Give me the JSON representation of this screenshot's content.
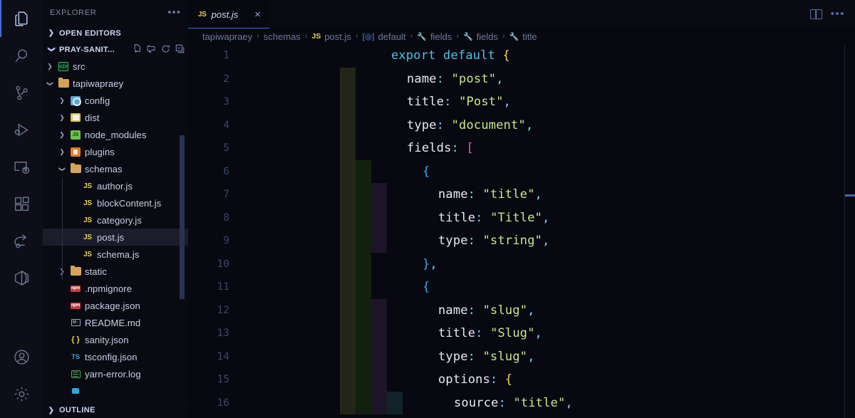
{
  "activitybar": {
    "items": [
      {
        "name": "explorer",
        "icon": "files-icon",
        "active": true
      },
      {
        "name": "search",
        "icon": "search-icon",
        "active": false
      },
      {
        "name": "source-control",
        "icon": "source-control-icon",
        "active": false
      },
      {
        "name": "run-and-debug",
        "icon": "run-debug-icon",
        "active": false
      },
      {
        "name": "remote-explorer",
        "icon": "remote-explorer-icon",
        "active": false
      },
      {
        "name": "extensions",
        "icon": "extensions-icon",
        "active": false
      },
      {
        "name": "live-share",
        "icon": "live-share-icon",
        "active": false
      },
      {
        "name": "docker",
        "icon": "docker-icon",
        "active": false
      }
    ],
    "bottom": [
      {
        "name": "accounts",
        "icon": "account-icon"
      },
      {
        "name": "manage-settings",
        "icon": "gear-icon"
      }
    ]
  },
  "sidebar": {
    "title": "EXPLORER",
    "more_actions": "•••",
    "sections": [
      {
        "label": "OPEN EDITORS",
        "expanded": false
      },
      {
        "label": "PRAY-SANIT...",
        "expanded": true,
        "actions": [
          "new-file",
          "new-folder",
          "refresh",
          "collapse-all"
        ]
      }
    ],
    "tree": [
      {
        "label": "src",
        "depth": 1,
        "kind": "folder",
        "icon": "src-folder-icon",
        "twisty": "collapsed",
        "selected": false
      },
      {
        "label": "tapiwapraey",
        "depth": 1,
        "kind": "folder",
        "icon": "folder-icon",
        "twisty": "expanded",
        "selected": false
      },
      {
        "label": "config",
        "depth": 2,
        "kind": "folder",
        "icon": "config-folder-icon",
        "twisty": "collapsed",
        "selected": false
      },
      {
        "label": "dist",
        "depth": 2,
        "kind": "folder",
        "icon": "dist-folder-icon",
        "twisty": "collapsed",
        "selected": false
      },
      {
        "label": "node_modules",
        "depth": 2,
        "kind": "folder",
        "icon": "node-folder-icon",
        "twisty": "collapsed",
        "selected": false
      },
      {
        "label": "plugins",
        "depth": 2,
        "kind": "folder",
        "icon": "plugins-folder-icon",
        "twisty": "collapsed",
        "selected": false
      },
      {
        "label": "schemas",
        "depth": 2,
        "kind": "folder",
        "icon": "folder-icon",
        "twisty": "expanded",
        "selected": false
      },
      {
        "label": "author.js",
        "depth": 3,
        "kind": "file",
        "icon": "js-file-icon",
        "twisty": "none",
        "selected": false
      },
      {
        "label": "blockContent.js",
        "depth": 3,
        "kind": "file",
        "icon": "js-file-icon",
        "twisty": "none",
        "selected": false
      },
      {
        "label": "category.js",
        "depth": 3,
        "kind": "file",
        "icon": "js-file-icon",
        "twisty": "none",
        "selected": false
      },
      {
        "label": "post.js",
        "depth": 3,
        "kind": "file",
        "icon": "js-file-icon",
        "twisty": "none",
        "selected": true
      },
      {
        "label": "schema.js",
        "depth": 3,
        "kind": "file",
        "icon": "js-file-icon",
        "twisty": "none",
        "selected": false
      },
      {
        "label": "static",
        "depth": 2,
        "kind": "folder",
        "icon": "folder-icon",
        "twisty": "collapsed",
        "selected": false
      },
      {
        "label": ".npmignore",
        "depth": 2,
        "kind": "file",
        "icon": "npm-file-icon",
        "twisty": "none",
        "selected": false
      },
      {
        "label": "package.json",
        "depth": 2,
        "kind": "file",
        "icon": "npm-file-icon",
        "twisty": "none",
        "selected": false
      },
      {
        "label": "README.md",
        "depth": 2,
        "kind": "file",
        "icon": "markdown-file-icon",
        "twisty": "none",
        "selected": false
      },
      {
        "label": "sanity.json",
        "depth": 2,
        "kind": "file",
        "icon": "json-file-icon",
        "twisty": "none",
        "selected": false
      },
      {
        "label": "tsconfig.json",
        "depth": 2,
        "kind": "file",
        "icon": "tsconfig-file-icon",
        "twisty": "none",
        "selected": false
      },
      {
        "label": "yarn-error.log",
        "depth": 2,
        "kind": "file",
        "icon": "log-file-icon",
        "twisty": "none",
        "selected": false
      },
      {
        "label": "",
        "depth": 2,
        "kind": "file",
        "icon": "lock-file-icon",
        "twisty": "none",
        "selected": false
      }
    ],
    "bottom_section": {
      "label": "OUTLINE",
      "expanded": false
    }
  },
  "editor": {
    "tabs": [
      {
        "label": "post.js",
        "icon": "js-file-icon",
        "active": true,
        "preview": true,
        "close": "×"
      }
    ],
    "actions": [
      {
        "name": "split-editor-right",
        "icon": "split-editor-icon"
      },
      {
        "name": "more-editor-actions",
        "icon": "ellipsis-icon"
      }
    ],
    "breadcrumbs": [
      {
        "label": "tapiwapraey",
        "icon": null
      },
      {
        "label": "schemas",
        "icon": null
      },
      {
        "label": "post.js",
        "icon": "js-file-icon"
      },
      {
        "label": "default",
        "icon": "symbol-object-icon"
      },
      {
        "label": "fields",
        "icon": "symbol-property-icon"
      },
      {
        "label": "fields",
        "icon": "symbol-property-icon"
      },
      {
        "label": "title",
        "icon": "symbol-property-icon"
      }
    ],
    "separator": "›",
    "language": "javascript",
    "first_visible_line": 1,
    "lines": [
      {
        "n": 1,
        "indent": 0,
        "tokens": [
          {
            "t": "export default ",
            "c": "kw"
          },
          {
            "t": "{",
            "c": "b1"
          }
        ]
      },
      {
        "n": 2,
        "indent": 1,
        "tokens": [
          {
            "t": "name",
            "c": "prop"
          },
          {
            "t": ": ",
            "c": "punc"
          },
          {
            "t": "\"post\"",
            "c": "str"
          },
          {
            "t": ",",
            "c": "punc"
          }
        ]
      },
      {
        "n": 3,
        "indent": 1,
        "tokens": [
          {
            "t": "title",
            "c": "prop"
          },
          {
            "t": ": ",
            "c": "punc"
          },
          {
            "t": "\"Post\"",
            "c": "str"
          },
          {
            "t": ",",
            "c": "punc"
          }
        ]
      },
      {
        "n": 4,
        "indent": 1,
        "tokens": [
          {
            "t": "type",
            "c": "prop"
          },
          {
            "t": ": ",
            "c": "punc"
          },
          {
            "t": "\"document\"",
            "c": "str"
          },
          {
            "t": ",",
            "c": "punc"
          }
        ]
      },
      {
        "n": 5,
        "indent": 1,
        "tokens": [
          {
            "t": "fields",
            "c": "prop"
          },
          {
            "t": ": ",
            "c": "punc"
          },
          {
            "t": "[",
            "c": "b2"
          }
        ]
      },
      {
        "n": 6,
        "indent": 2,
        "tokens": [
          {
            "t": "{",
            "c": "b3"
          }
        ]
      },
      {
        "n": 7,
        "indent": 3,
        "tokens": [
          {
            "t": "name",
            "c": "prop"
          },
          {
            "t": ": ",
            "c": "punc"
          },
          {
            "t": "\"title\"",
            "c": "str"
          },
          {
            "t": ",",
            "c": "punc"
          }
        ]
      },
      {
        "n": 8,
        "indent": 3,
        "tokens": [
          {
            "t": "title",
            "c": "prop"
          },
          {
            "t": ": ",
            "c": "punc"
          },
          {
            "t": "\"Title\"",
            "c": "str"
          },
          {
            "t": ",",
            "c": "punc"
          }
        ]
      },
      {
        "n": 9,
        "indent": 3,
        "tokens": [
          {
            "t": "type",
            "c": "prop"
          },
          {
            "t": ": ",
            "c": "punc"
          },
          {
            "t": "\"string\"",
            "c": "str"
          },
          {
            "t": ",",
            "c": "punc"
          }
        ]
      },
      {
        "n": 10,
        "indent": 2,
        "tokens": [
          {
            "t": "}",
            "c": "b3"
          },
          {
            "t": ",",
            "c": "punc"
          }
        ]
      },
      {
        "n": 11,
        "indent": 2,
        "tokens": [
          {
            "t": "{",
            "c": "b3"
          }
        ]
      },
      {
        "n": 12,
        "indent": 3,
        "tokens": [
          {
            "t": "name",
            "c": "prop"
          },
          {
            "t": ": ",
            "c": "punc"
          },
          {
            "t": "\"slug\"",
            "c": "str"
          },
          {
            "t": ",",
            "c": "punc"
          }
        ]
      },
      {
        "n": 13,
        "indent": 3,
        "tokens": [
          {
            "t": "title",
            "c": "prop"
          },
          {
            "t": ": ",
            "c": "punc"
          },
          {
            "t": "\"Slug\"",
            "c": "str"
          },
          {
            "t": ",",
            "c": "punc"
          }
        ]
      },
      {
        "n": 14,
        "indent": 3,
        "tokens": [
          {
            "t": "type",
            "c": "prop"
          },
          {
            "t": ": ",
            "c": "punc"
          },
          {
            "t": "\"slug\"",
            "c": "str"
          },
          {
            "t": ",",
            "c": "punc"
          }
        ]
      },
      {
        "n": 15,
        "indent": 3,
        "tokens": [
          {
            "t": "options",
            "c": "prop"
          },
          {
            "t": ": ",
            "c": "punc"
          },
          {
            "t": "{",
            "c": "b1"
          }
        ]
      },
      {
        "n": 16,
        "indent": 4,
        "tokens": [
          {
            "t": "source",
            "c": "prop"
          },
          {
            "t": ": ",
            "c": "punc"
          },
          {
            "t": "\"title\"",
            "c": "str"
          },
          {
            "t": ",",
            "c": "punc"
          }
        ]
      }
    ]
  },
  "colors": {
    "editor_background": "#070810",
    "sidebar_background": "#0a0b12",
    "activitybar_background": "#0d0e17",
    "accent": "#3f6fd8",
    "keyword": "#4fc3e8",
    "string": "#c9e98a",
    "property": "#e6ebf5",
    "punctuation": "#7fd4f5",
    "bracket_level_1": "#f2d85c",
    "bracket_level_2": "#e05fc0",
    "bracket_level_3": "#35a6f0",
    "line_number": "#3e4668",
    "selection_row": "#1b1d2b",
    "indent_block_1": "#232616",
    "indent_block_2": "#12210f",
    "indent_block_3": "#1d1427",
    "indent_block_4": "#0f2429"
  }
}
